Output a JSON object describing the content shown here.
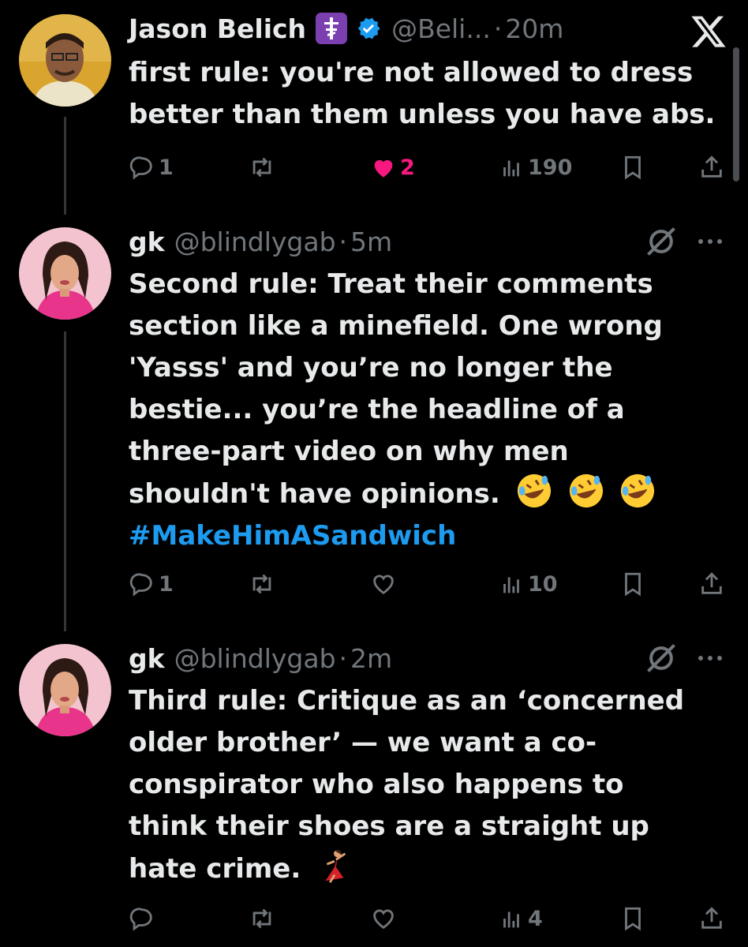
{
  "window": {
    "logo": "x-logo-icon"
  },
  "tweets": [
    {
      "name": "Jason Belich",
      "handle": "@Beli...",
      "time": "20m",
      "text_lines": [
        "first rule: you're not allowed to dress",
        "better than them unless you have abs."
      ],
      "hashtag": "",
      "emoji": [],
      "replies": "1",
      "retweets": "",
      "likes": "2",
      "liked": true,
      "views": "190"
    },
    {
      "name": "gk",
      "handle": "@blindlygab",
      "time": "5m",
      "text_lines": [
        "Second rule: Treat their comments",
        "section like a minefield. One wrong",
        "'Yasss' and you’re no longer the",
        "bestie... you’re the headline of a",
        "three-part video on why men",
        "shouldn't have opinions."
      ],
      "hashtag": "#MakeHimASandwich",
      "emoji": [
        "rofl-emoji",
        "rofl-emoji",
        "rofl-emoji"
      ],
      "replies": "1",
      "retweets": "",
      "likes": "",
      "liked": false,
      "views": "10"
    },
    {
      "name": "gk",
      "handle": "@blindlygab",
      "time": "2m",
      "text_lines": [
        "Third rule: Critique as an ‘concerned",
        "older brother’ — we want a co-",
        "conspirator who also happens to",
        "think their shoes are a straight up",
        "hate crime."
      ],
      "hashtag": "",
      "emoji": [
        "dancer-emoji"
      ],
      "replies": "",
      "retweets": "",
      "likes": "",
      "liked": false,
      "views": "4"
    }
  ],
  "colors": {
    "background": "#000000",
    "text": "#e7e9ea",
    "muted": "#71767b",
    "link": "#1d9bf0",
    "like": "#f91880",
    "verified": "#1d9bf0"
  }
}
